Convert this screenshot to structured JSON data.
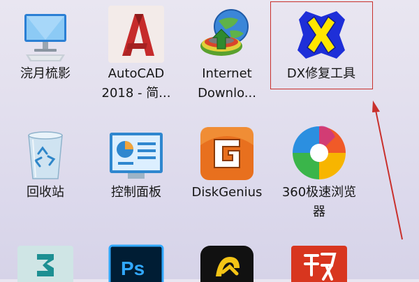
{
  "desktop": {
    "icons": [
      {
        "name": "浣月梳影",
        "icon": "computer-icon"
      },
      {
        "name": "AutoCAD\n2018 - 简...",
        "icon": "autocad-icon"
      },
      {
        "name": "Internet\nDownlo...",
        "icon": "internet-download-manager-icon"
      },
      {
        "name": "DX修复工具",
        "icon": "dx-repair-tool-icon"
      },
      {
        "name": "回收站",
        "icon": "recycle-bin-icon"
      },
      {
        "name": "控制面板",
        "icon": "control-panel-icon"
      },
      {
        "name": "DiskGenius",
        "icon": "diskgenius-icon"
      },
      {
        "name": "360极速浏览\n器",
        "icon": "360-browser-icon"
      },
      {
        "name": "",
        "icon": "3ds-max-icon"
      },
      {
        "name": "",
        "icon": "photoshop-icon"
      },
      {
        "name": "",
        "icon": "tencent-app-icon"
      },
      {
        "name": "",
        "icon": "red-chinese-app-icon"
      }
    ]
  },
  "annotation": {
    "highlight_color": "#c9302c"
  },
  "colors": {
    "autocad_red": "#c62b2b",
    "dx_blue": "#1e2fd8",
    "dx_yellow": "#ffe600",
    "diskgenius_orange": "#e8701e",
    "photoshop_blue": "#31a8ff"
  }
}
